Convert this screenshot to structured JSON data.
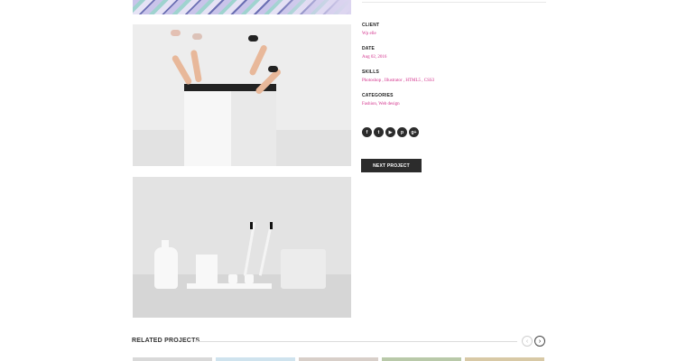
{
  "meta": {
    "client_label": "CLIENT",
    "client_value": "Wp elle",
    "date_label": "DATE",
    "date_value": "Aug 02, 2016",
    "skills_label": "SKILLS",
    "skills_value": "Photoshop , Illustrator , HTML5 , CSS3",
    "categories_label": "CATEGORIES",
    "categories_value": "Fashion, Web design"
  },
  "socials": [
    {
      "icon": "facebook-icon",
      "glyph": "f"
    },
    {
      "icon": "twitter-icon",
      "glyph": "t"
    },
    {
      "icon": "youtube-icon",
      "glyph": "▶"
    },
    {
      "icon": "pinterest-icon",
      "glyph": "p"
    },
    {
      "icon": "google-plus-icon",
      "glyph": "g+"
    }
  ],
  "next_button_label": "NEXT PROJECT",
  "related": {
    "title": "RELATED PROJECTS",
    "prev_glyph": "‹",
    "next_glyph": "›",
    "thumb_colors": [
      "#d9d9d9",
      "#cfe3ee",
      "#d8cfc9",
      "#b9c9a9",
      "#d8c9a6"
    ]
  },
  "colors": {
    "accent": "#d22e8a",
    "button_bg": "#2c2c2c"
  }
}
